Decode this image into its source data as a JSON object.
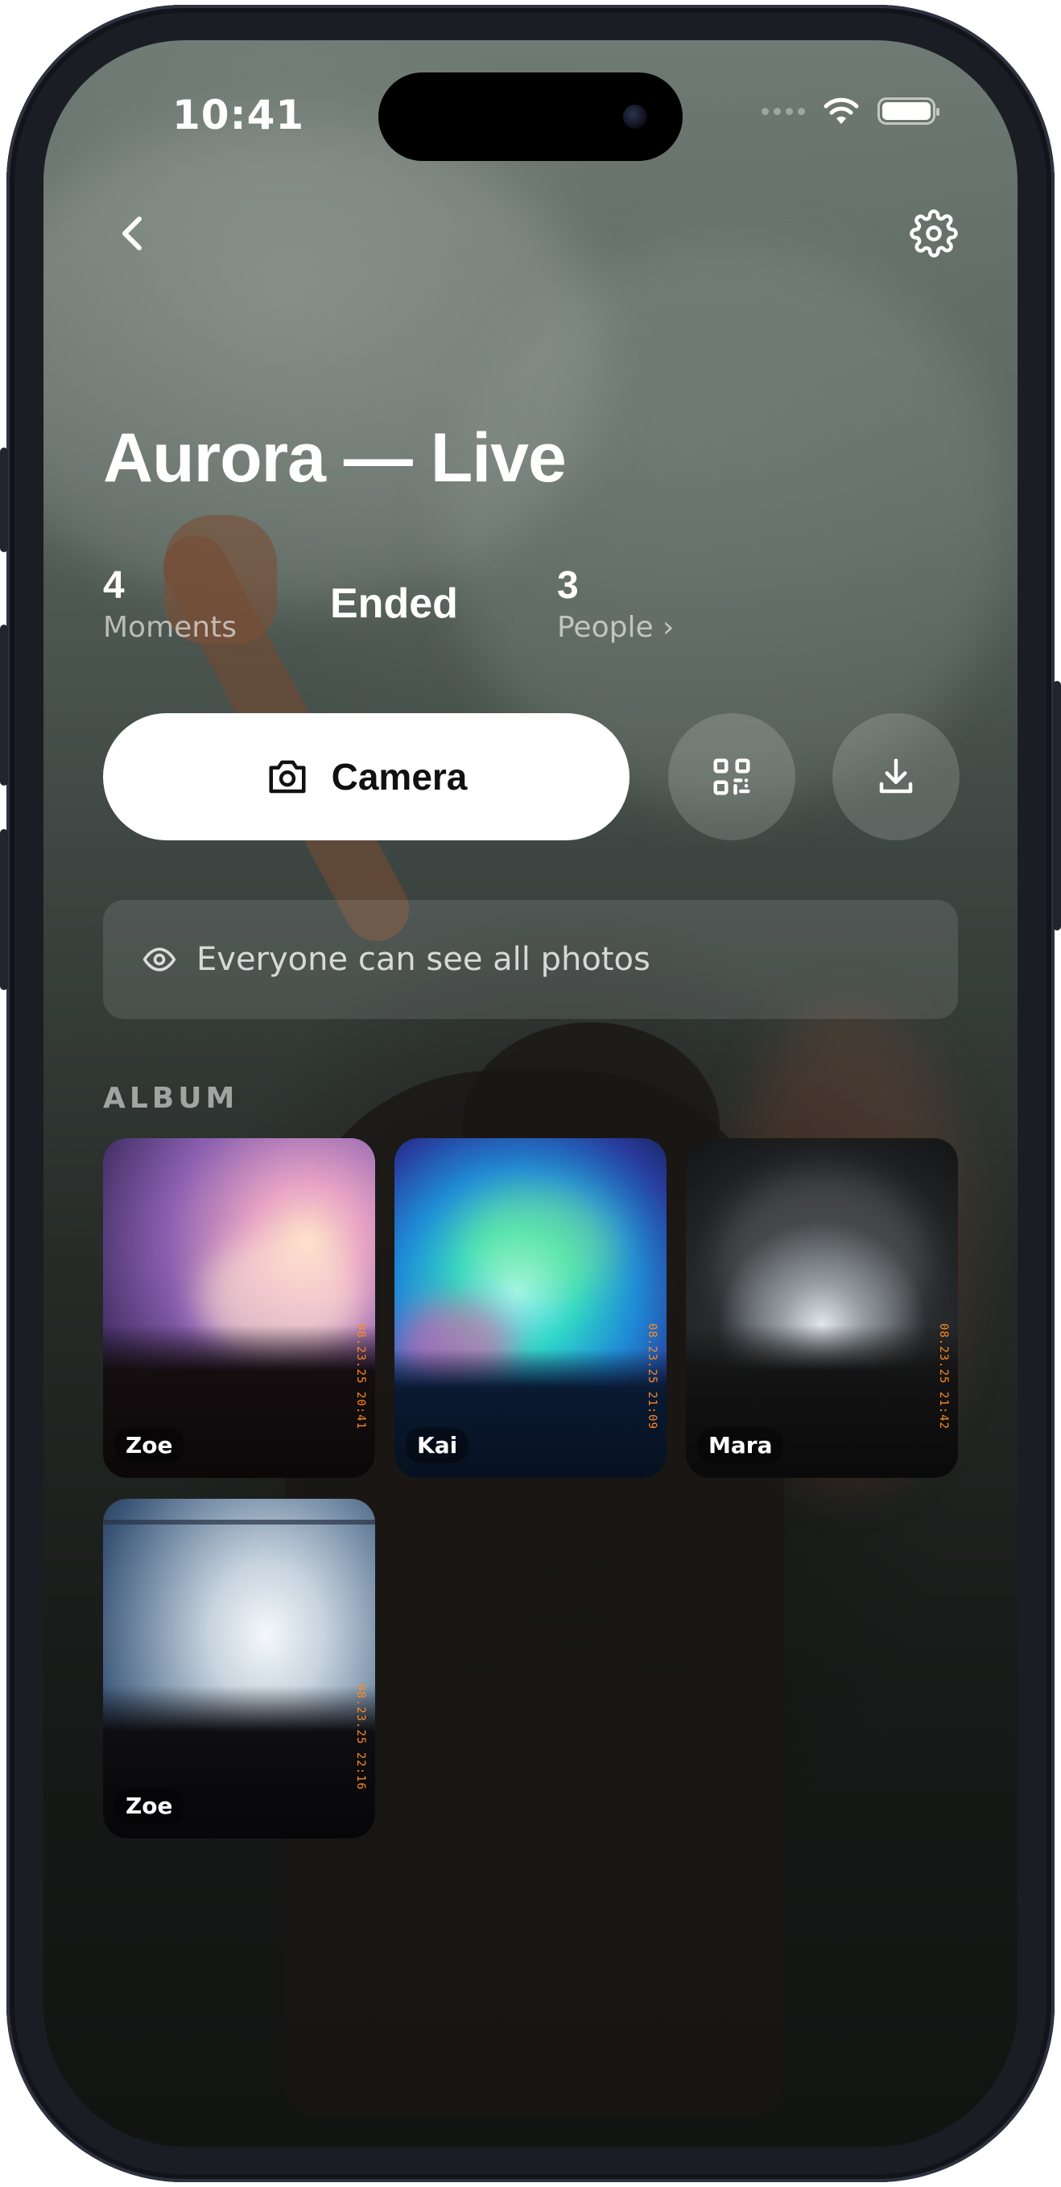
{
  "status_bar": {
    "time": "10:41"
  },
  "nav": {
    "back_icon": "chevron-left-icon",
    "settings_icon": "gear-icon"
  },
  "event": {
    "title": "Aurora — Live",
    "stats": {
      "moments_value": "4",
      "moments_label": "Moments",
      "status": "Ended",
      "people_value": "3",
      "people_label": "People ›"
    }
  },
  "actions": {
    "camera_label": "Camera",
    "camera_icon": "camera-icon",
    "qr_icon": "qr-code-icon",
    "download_icon": "download-icon"
  },
  "visibility": {
    "icon": "eye-icon",
    "text": "Everyone can see all photos"
  },
  "album": {
    "label": "ALBUM",
    "photos": [
      {
        "author": "Zoe",
        "stamp": "08.23.25 20:41"
      },
      {
        "author": "Kai",
        "stamp": "08.23.25 21:09"
      },
      {
        "author": "Mara",
        "stamp": "08.23.25 21:42"
      },
      {
        "author": "Zoe",
        "stamp": "08.23.25 22:16"
      }
    ]
  },
  "colors": {
    "accent": "#ffffff",
    "stamp": "#ff8a1f"
  }
}
